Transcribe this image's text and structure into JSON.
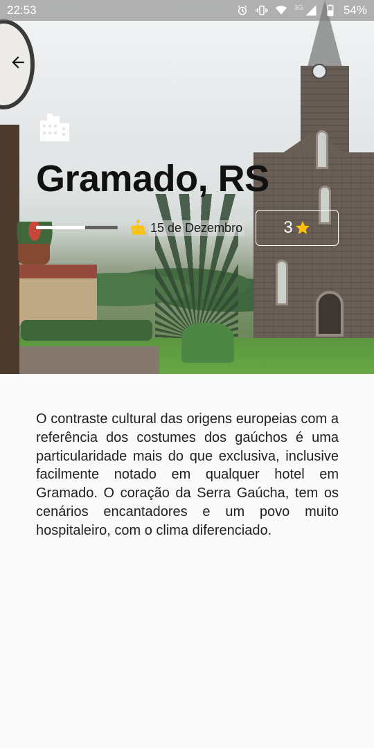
{
  "status_bar": {
    "time": "22:53",
    "network": "3G",
    "battery": "54%",
    "icons": [
      "alarm-icon",
      "vibrate-icon",
      "wifi-icon",
      "signal-icon",
      "battery-icon"
    ]
  },
  "header": {
    "back_icon": "arrow-left-icon",
    "category_icon": "building-icon",
    "title": "Gramado, RS"
  },
  "info": {
    "progress": 0.6,
    "birthday_icon": "cake-icon",
    "date": "15 de Dezembro",
    "rating": "3",
    "rating_icon": "star-icon"
  },
  "description": "O contraste cultural das origens europeias com a referência dos costumes dos gaúchos é uma particularidade mais do que exclusiva, inclusive facilmente notado em qualquer hotel em Gramado. O coração da Serra Gaúcha, tem os cenários encantadores e um povo muito hospitaleiro, com o clima diferenciado.",
  "colors": {
    "star": "#FFC107",
    "cake": "#FFC107",
    "background": "#FAFAFA",
    "title": "#111111"
  }
}
